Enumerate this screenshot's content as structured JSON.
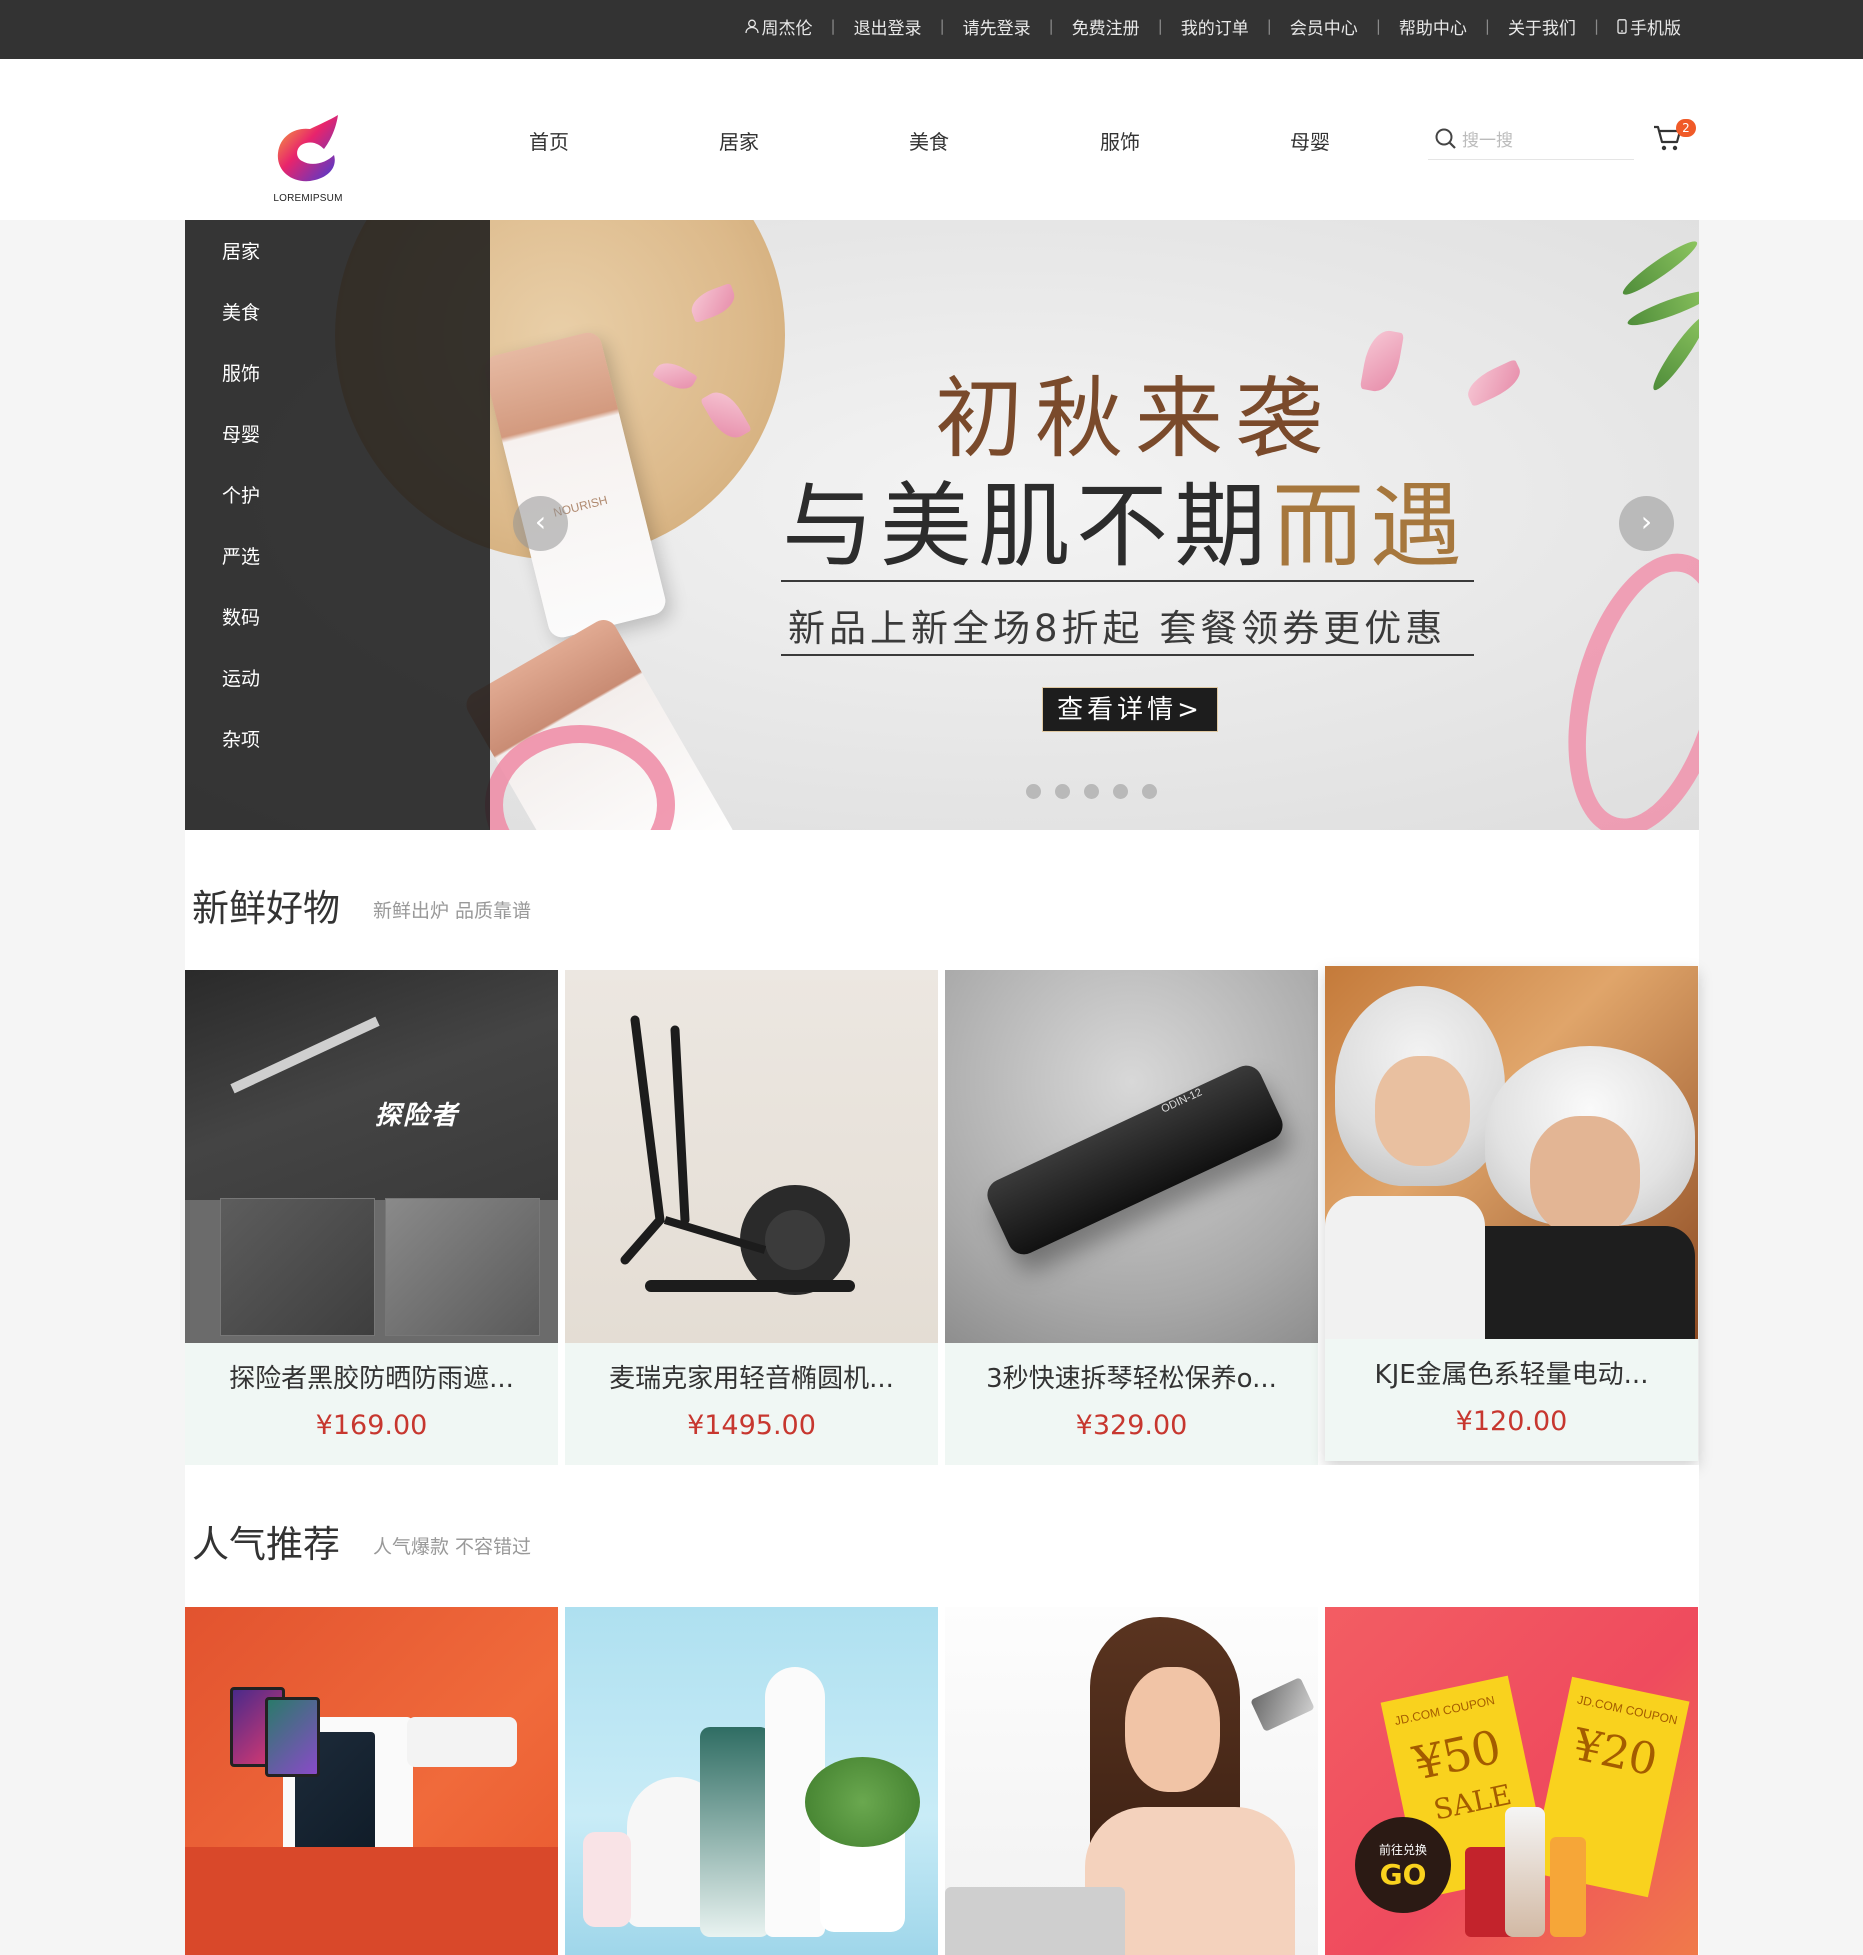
{
  "topbar": {
    "links": [
      {
        "label": "周杰伦",
        "icon": "user-icon"
      },
      {
        "label": "退出登录"
      },
      {
        "label": "请先登录"
      },
      {
        "label": "免费注册"
      },
      {
        "label": "我的订单"
      },
      {
        "label": "会员中心"
      },
      {
        "label": "帮助中心"
      },
      {
        "label": "关于我们"
      },
      {
        "label": "手机版",
        "icon": "phone-icon"
      }
    ],
    "separator": "|"
  },
  "header": {
    "logo_text": "LOREMIPSUM",
    "nav": [
      "首页",
      "居家",
      "美食",
      "服饰",
      "母婴"
    ],
    "search_placeholder": "搜一搜",
    "cart_count": "2"
  },
  "categories": [
    "居家",
    "美食",
    "服饰",
    "母婴",
    "个护",
    "严选",
    "数码",
    "运动",
    "杂项"
  ],
  "banner": {
    "title_line1": "初秋来袭",
    "title_line2_head": "与美肌不期",
    "title_line2_tail": "而遇",
    "subtitle": "新品上新全场8折起 套餐领券更优惠",
    "button": "查看详情>",
    "product_label": "NOURISH",
    "prev_arrow": "‹",
    "next_arrow": "›",
    "dot_count": 5
  },
  "fresh": {
    "title": "新鲜好物",
    "subtitle": "新鲜出炉 品质靠谱",
    "items": [
      {
        "name": "探险者黑胶防晒防雨遮...",
        "price": "¥169.00",
        "image_text": "探险者"
      },
      {
        "name": "麦瑞克家用轻音椭圆机...",
        "price": "¥1495.00"
      },
      {
        "name": "3秒快速拆琴轻松保养o...",
        "price": "¥329.00",
        "image_text": "ODIN-12"
      },
      {
        "name": "KJE金属色系轻量电动...",
        "price": "¥120.00"
      }
    ]
  },
  "popular": {
    "title": "人气推荐",
    "subtitle": "人气爆款 不容错过",
    "coupon_texts": [
      "JD.COM COUPON",
      "¥50",
      "SALE",
      "JD.COM COUPON",
      "¥20",
      "前往兑换",
      "GO"
    ]
  },
  "colors": {
    "topbar_bg": "#333333",
    "price": "#c7372f",
    "card_bg": "#f0f7f4",
    "badge": "#f05a28"
  }
}
